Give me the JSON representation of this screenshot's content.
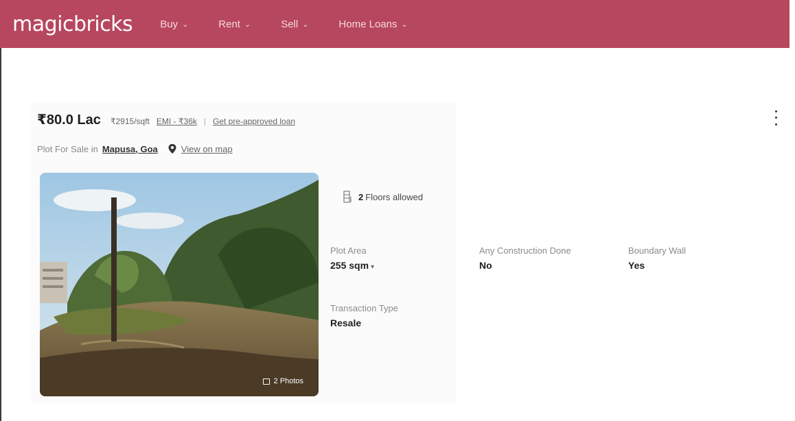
{
  "header": {
    "logo": "magicbricks",
    "nav": [
      {
        "label": "Buy"
      },
      {
        "label": "Rent"
      },
      {
        "label": "Sell"
      },
      {
        "label": "Home Loans"
      }
    ],
    "colors": {
      "bar": "#b7475f",
      "text": "#f6d8de"
    }
  },
  "listing": {
    "price": "₹80.0 Lac",
    "price_per_sqft": "₹2915/sqft",
    "emi": "EMI - ₹36k",
    "separator": "|",
    "loan_link": "Get pre-approved loan",
    "location_prefix": "Plot For Sale in",
    "location": "Mapusa, Goa",
    "map_link": "View on map",
    "photo_count": "2 Photos",
    "floors_value": "2",
    "floors_text": "Floors allowed",
    "fields": {
      "plot_area": {
        "label": "Plot Area",
        "value": "255 sqm"
      },
      "construction": {
        "label": "Any Construction Done",
        "value": "No"
      },
      "boundary": {
        "label": "Boundary Wall",
        "value": "Yes"
      },
      "transaction": {
        "label": "Transaction Type",
        "value": "Resale"
      }
    }
  },
  "icons": {
    "more": "more-vertical-icon",
    "pin": "map-pin-icon",
    "floors": "floors-icon",
    "photos": "photo-icon"
  }
}
